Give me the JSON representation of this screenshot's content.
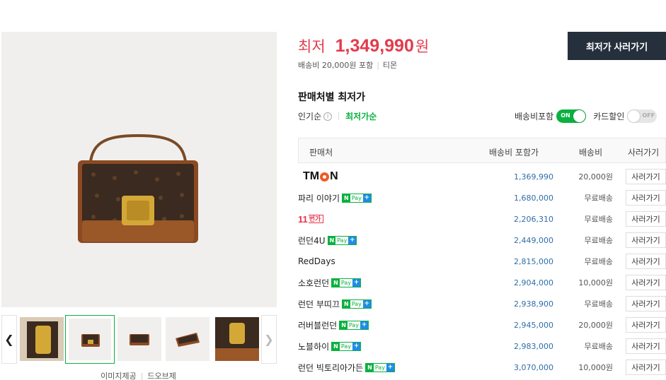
{
  "gallery": {
    "footer_provider": "이미지제공",
    "footer_brand": "드오브제",
    "thumb_count": 5,
    "active_thumb": 2
  },
  "price": {
    "label": "최저",
    "value": "1,349,990",
    "unit": "원",
    "shipping": "배송비 20,000원 포함",
    "seller": "티몬",
    "accent_color": "#e33b4b"
  },
  "buy_button": "최저가 사러가기",
  "sellers_section": {
    "title": "판매처별 최저가",
    "sort_popular": "인기순",
    "sort_lowest": "최저가순",
    "toggle_shipping_label": "배송비포함",
    "toggle_shipping_state": "ON",
    "toggle_card_label": "카드할인",
    "toggle_card_state": "OFF"
  },
  "table": {
    "headers": [
      "판매처",
      "배송비 포함가",
      "배송비",
      "사러가기"
    ],
    "rows": [
      {
        "seller": "TMON",
        "logo": "tmon",
        "npay": false,
        "price": "1,369,990",
        "fee": "20,000원",
        "button": "사러가기"
      },
      {
        "seller": "파리 이야기",
        "logo": "",
        "npay": true,
        "price": "1,680,000",
        "fee": "무료배송",
        "button": "사러가기"
      },
      {
        "seller": "11번가",
        "logo": "11st",
        "npay": false,
        "price": "2,206,310",
        "fee": "무료배송",
        "button": "사러가기"
      },
      {
        "seller": "런던4U",
        "logo": "",
        "npay": true,
        "price": "2,449,000",
        "fee": "무료배송",
        "button": "사러가기"
      },
      {
        "seller": "RedDays",
        "logo": "",
        "npay": false,
        "price": "2,815,000",
        "fee": "무료배송",
        "button": "사러가기"
      },
      {
        "seller": "소호런던",
        "logo": "",
        "npay": true,
        "price": "2,904,000",
        "fee": "10,000원",
        "button": "사러가기"
      },
      {
        "seller": "런던 부띠끄",
        "logo": "",
        "npay": true,
        "price": "2,938,900",
        "fee": "무료배송",
        "button": "사러가기"
      },
      {
        "seller": "러버블런던",
        "logo": "",
        "npay": true,
        "price": "2,945,000",
        "fee": "20,000원",
        "button": "사러가기"
      },
      {
        "seller": "노블하이",
        "logo": "",
        "npay": true,
        "price": "2,983,000",
        "fee": "무료배송",
        "button": "사러가기"
      },
      {
        "seller": "런던 빅토리아가든",
        "logo": "",
        "npay": true,
        "price": "3,070,000",
        "fee": "10,000원",
        "button": "사러가기"
      }
    ]
  },
  "npay_badge": {
    "n": "N",
    "pay": "Pay",
    "plus": "+"
  },
  "colors": {
    "green": "#0ab140",
    "dark_button": "#26303d",
    "price_link": "#2f6ea8"
  }
}
